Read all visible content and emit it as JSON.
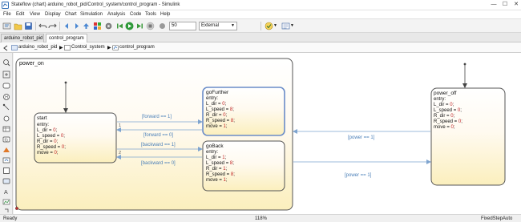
{
  "window": {
    "title": "Stateflow (chart) arduino_robot_pid/Control_system/control_program - Simulink",
    "controls": [
      "—",
      "☐",
      "✕"
    ]
  },
  "menu": [
    "File",
    "Edit",
    "View",
    "Display",
    "Chart",
    "Simulation",
    "Analysis",
    "Code",
    "Tools",
    "Help"
  ],
  "toolbar": {
    "stop_time": "50",
    "mode": "External"
  },
  "tabs": [
    {
      "label": "arduino_robot_pid",
      "active": false
    },
    {
      "label": "control_program",
      "active": true
    }
  ],
  "breadcrumb": [
    "arduino_robot_pid",
    "Control_system",
    "control_program"
  ],
  "chart": {
    "power_on": {
      "name": "power_on"
    },
    "start": {
      "name": "start",
      "entry": "entry:",
      "actions": [
        {
          "var": "L_dir = ",
          "val": "0",
          "end": ";"
        },
        {
          "var": "L_speed = ",
          "val": "0",
          "end": ";"
        },
        {
          "var": "R_dir = ",
          "val": "0",
          "end": ";"
        },
        {
          "var": "R_speed = ",
          "val": "0",
          "end": ";"
        },
        {
          "var": "move = ",
          "val": "0",
          "end": ";"
        }
      ]
    },
    "goFurther": {
      "name": "goFurther",
      "entry": "entry:",
      "actions": [
        {
          "var": "L_dir = ",
          "val": "0",
          "end": ";"
        },
        {
          "var": "L_speed = ",
          "val": "8",
          "end": ";"
        },
        {
          "var": "R_dir = ",
          "val": "0",
          "end": ";"
        },
        {
          "var": "R_speed = ",
          "val": "8",
          "end": ";"
        },
        {
          "var": "move = ",
          "val": "1",
          "end": ";"
        }
      ]
    },
    "goBack": {
      "name": "goBack",
      "entry": "entry:",
      "actions": [
        {
          "var": "L_dir = ",
          "val": "1",
          "end": ";"
        },
        {
          "var": "L_speed = ",
          "val": "8",
          "end": ";"
        },
        {
          "var": "R_dir = ",
          "val": "1",
          "end": ";"
        },
        {
          "var": "R_speed = ",
          "val": "8",
          "end": ";"
        },
        {
          "var": "move = ",
          "val": "1",
          "end": ";"
        }
      ]
    },
    "power_off": {
      "name": "power_off",
      "entry": "entry:",
      "actions": [
        {
          "var": "L_dir = ",
          "val": "0",
          "end": ";"
        },
        {
          "var": "L_speed = ",
          "val": "0",
          "end": ";"
        },
        {
          "var": "R_dir = ",
          "val": "0",
          "end": ";"
        },
        {
          "var": "R_speed = ",
          "val": "0",
          "end": ";"
        },
        {
          "var": "move = ",
          "val": "0",
          "end": ";"
        }
      ]
    },
    "transitions": {
      "forward_on": "[forward == 1]",
      "forward_off": "[forward == 0]",
      "backward_on": "[backward == 1]",
      "backward_off": "[backward == 0]",
      "power_on_to_off": "[power == 1]",
      "power_off_to_on": "[power == 1]",
      "order_1": "1",
      "order_2": "2"
    },
    "colors": {
      "state_border": "#555555",
      "state_fill_top": "#ffffff",
      "state_fill_bottom": "#fbf0c4",
      "selected_border": "#6a8cc8",
      "transition_label": "#4a7fb8",
      "value": "#c02020"
    }
  },
  "status": {
    "left": "Ready",
    "zoom": "118%",
    "solver": "FixedStepAuto"
  }
}
